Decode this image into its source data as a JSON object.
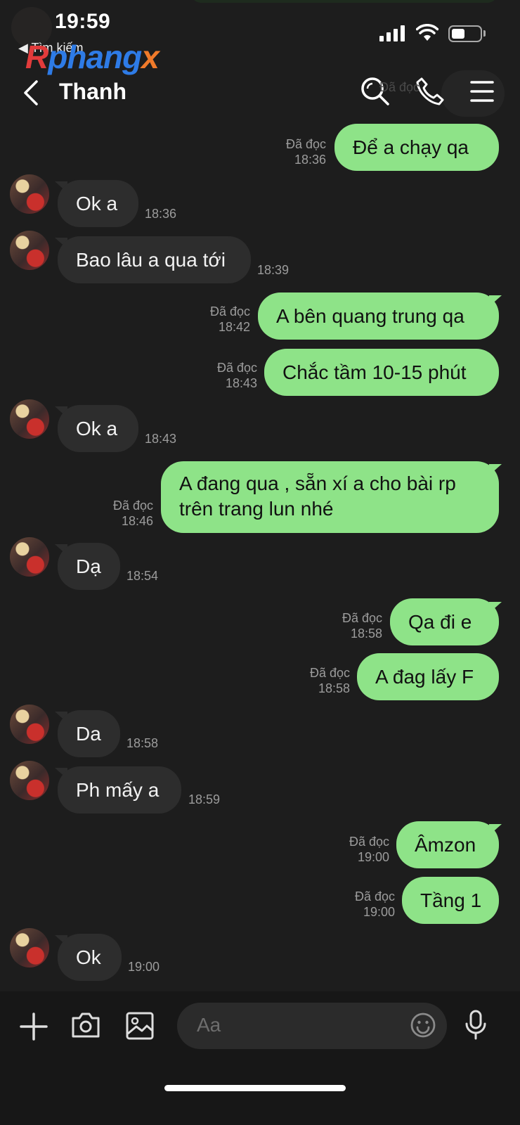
{
  "status": {
    "time": "19:59",
    "back_label": "◀ Tìm kiếm"
  },
  "brand": {
    "part1": "R",
    "part2": "phang",
    "part3": "x"
  },
  "header": {
    "title": "Thanh",
    "icons": [
      "back-icon",
      "search-icon",
      "phone-icon",
      "menu-icon"
    ]
  },
  "ghost": {
    "text": "Đã đọc"
  },
  "messages": [
    {
      "dir": "out",
      "text": "Để a chạy qa",
      "status": "Đã đọc",
      "time": "18:36"
    },
    {
      "dir": "in",
      "text": "Ok a",
      "time": "18:36"
    },
    {
      "dir": "in",
      "text": "Bao lâu a qua tới",
      "time": "18:39"
    },
    {
      "dir": "out",
      "text": "A bên quang trung qa",
      "status": "Đã đọc",
      "time": "18:42"
    },
    {
      "dir": "out",
      "text": "Chắc tầm 10-15 phút",
      "status": "Đã đọc",
      "time": "18:43"
    },
    {
      "dir": "in",
      "text": "Ok a",
      "time": "18:43"
    },
    {
      "dir": "out",
      "text": "A đang qua , sẵn xí a cho bài rp trên trang lun nhé",
      "status": "Đã đọc",
      "time": "18:46"
    },
    {
      "dir": "in",
      "text": "Dạ",
      "time": "18:54"
    },
    {
      "dir": "out",
      "text": "Qa đi e",
      "status": "Đã đọc",
      "time": "18:58"
    },
    {
      "dir": "out",
      "text": "A đag lấy F",
      "status": "Đã đọc",
      "time": "18:58"
    },
    {
      "dir": "in",
      "text": "Da",
      "time": "18:58"
    },
    {
      "dir": "in",
      "text": "Ph mấy a",
      "time": "18:59"
    },
    {
      "dir": "out",
      "text": "Âmzon",
      "status": "Đã đọc",
      "time": "19:00"
    },
    {
      "dir": "out",
      "text": "Tầng 1",
      "status": "Đã đọc",
      "time": "19:00"
    },
    {
      "dir": "in",
      "text": "Ok",
      "time": "19:00"
    }
  ],
  "composer": {
    "placeholder": "Aa"
  },
  "colors": {
    "outgoing_bubble": "#8ee388",
    "incoming_bubble": "#2d2d2d",
    "background": "#1d1d1d"
  }
}
